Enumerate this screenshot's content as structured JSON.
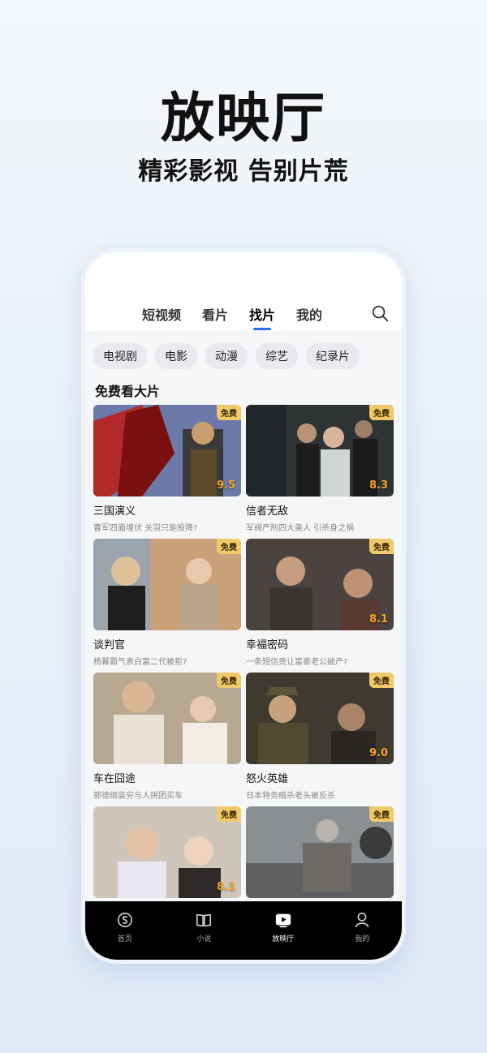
{
  "hero": {
    "title": "放映厅",
    "subtitle": "精彩影视 告别片荒"
  },
  "header": {
    "tabs": [
      {
        "label": "短视频",
        "active": false
      },
      {
        "label": "看片",
        "active": false
      },
      {
        "label": "找片",
        "active": true
      },
      {
        "label": "我的",
        "active": false
      }
    ],
    "search_icon": "search-icon"
  },
  "categories": [
    "电视剧",
    "电影",
    "动漫",
    "综艺",
    "纪录片"
  ],
  "section": {
    "title": "免费看大片"
  },
  "accent": "#2b6cf6",
  "movies": [
    {
      "title": "三国演义",
      "desc": "曹军四面埋伏 关羽只能投降?",
      "score": "9.5",
      "badge": "免费"
    },
    {
      "title": "信者无敌",
      "desc": "军阀严刑四大美人 引杀身之祸",
      "score": "8.3",
      "badge": "免费"
    },
    {
      "title": "谈判官",
      "desc": "杨幂霸气表白富二代被拒?",
      "score": "",
      "badge": "免费"
    },
    {
      "title": "幸福密码",
      "desc": "一条短信竟让富豪老公破产?",
      "score": "8.1",
      "badge": "免费"
    },
    {
      "title": "车在囧途",
      "desc": "郭德纲装穷与人拼团买车",
      "score": "",
      "badge": "免费"
    },
    {
      "title": "怒火英雄",
      "desc": "日本特务暗杀老头被反杀",
      "score": "9.0",
      "badge": "免费"
    },
    {
      "title": "",
      "desc": "",
      "score": "8.1",
      "badge": "免费"
    },
    {
      "title": "",
      "desc": "",
      "score": "",
      "badge": "免费"
    }
  ],
  "bottom_nav": [
    {
      "label": "首页",
      "icon": "home-icon",
      "active": false
    },
    {
      "label": "小说",
      "icon": "book-icon",
      "active": false
    },
    {
      "label": "放映厅",
      "icon": "play-icon",
      "active": true
    },
    {
      "label": "我的",
      "icon": "profile-icon",
      "active": false
    }
  ]
}
